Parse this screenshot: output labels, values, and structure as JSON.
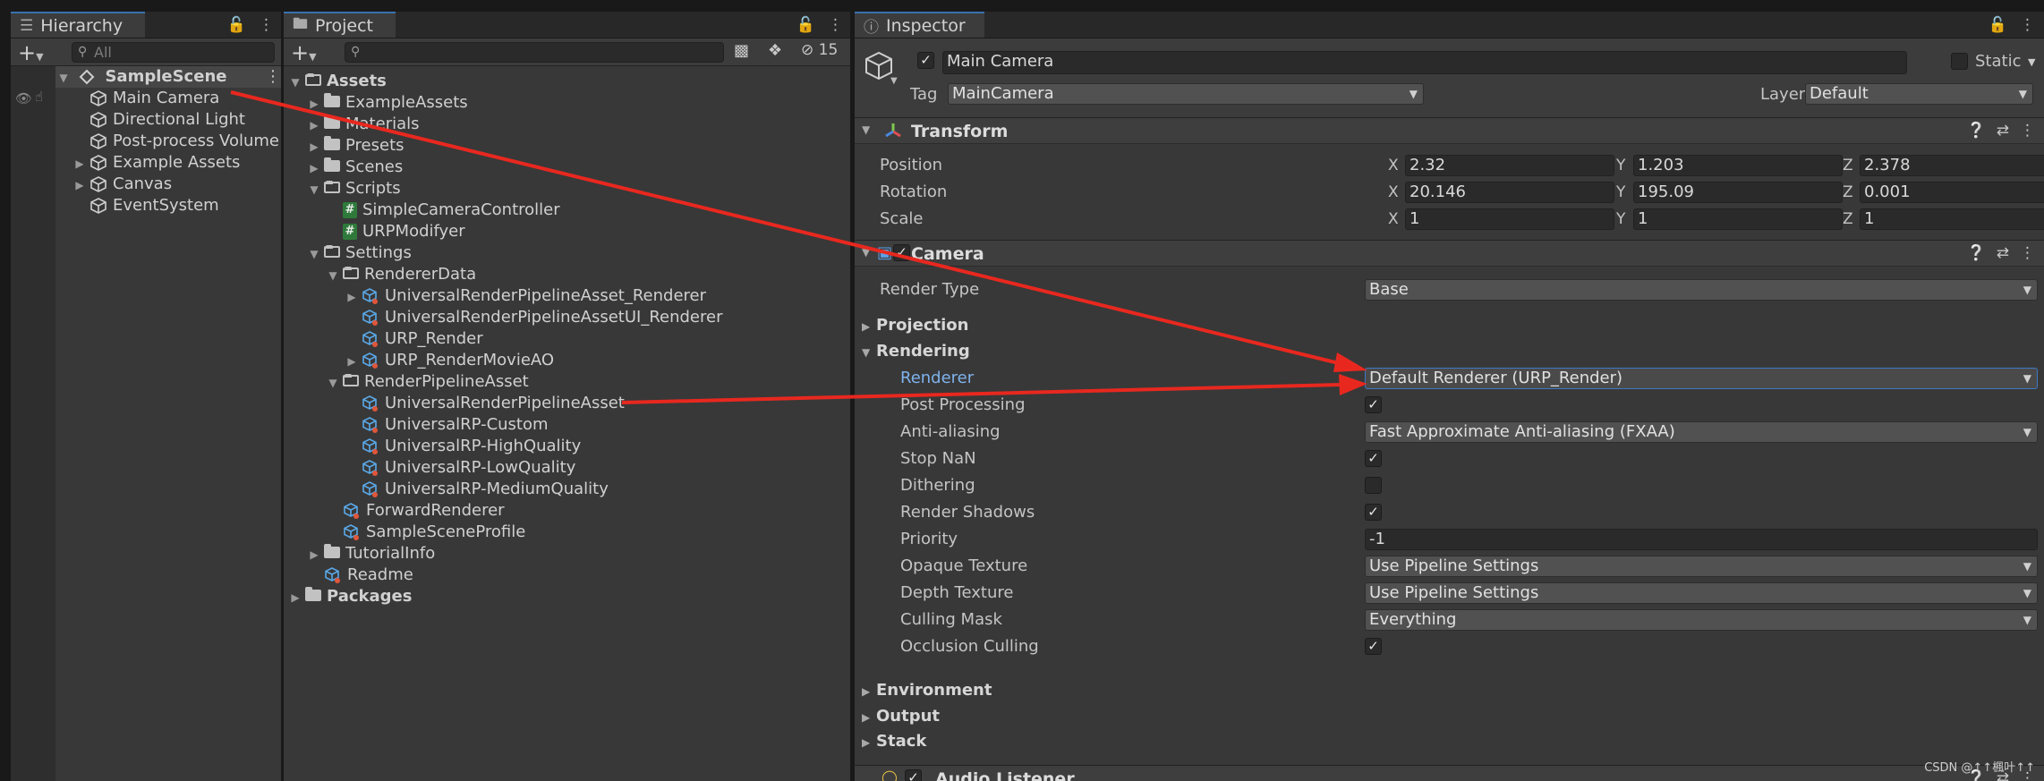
{
  "hierarchy": {
    "tab_label": "Hierarchy",
    "search_placeholder": "All",
    "scene": "SampleScene",
    "items": [
      "Main Camera",
      "Directional Light",
      "Post-process Volume",
      "Example Assets",
      "Canvas",
      "EventSystem"
    ]
  },
  "project": {
    "tab_label": "Project",
    "hidden_count": "15",
    "tree": [
      {
        "label": "Assets",
        "depth": 0,
        "kind": "folder-open",
        "fold": "open",
        "bold": true
      },
      {
        "label": "ExampleAssets",
        "depth": 1,
        "kind": "folder",
        "fold": "closed"
      },
      {
        "label": "Materials",
        "depth": 1,
        "kind": "folder",
        "fold": "closed"
      },
      {
        "label": "Presets",
        "depth": 1,
        "kind": "folder",
        "fold": "closed"
      },
      {
        "label": "Scenes",
        "depth": 1,
        "kind": "folder",
        "fold": "closed"
      },
      {
        "label": "Scripts",
        "depth": 1,
        "kind": "folder-open",
        "fold": "open"
      },
      {
        "label": "SimpleCameraController",
        "depth": 2,
        "kind": "script",
        "fold": "none"
      },
      {
        "label": "URPModifyer",
        "depth": 2,
        "kind": "script",
        "fold": "none"
      },
      {
        "label": "Settings",
        "depth": 1,
        "kind": "folder-open",
        "fold": "open"
      },
      {
        "label": "RendererData",
        "depth": 2,
        "kind": "folder-open",
        "fold": "open"
      },
      {
        "label": "UniversalRenderPipelineAsset_Renderer",
        "depth": 3,
        "kind": "asset",
        "fold": "closed"
      },
      {
        "label": "UniversalRenderPipelineAssetUI_Renderer",
        "depth": 3,
        "kind": "asset",
        "fold": "none"
      },
      {
        "label": "URP_Render",
        "depth": 3,
        "kind": "asset",
        "fold": "none"
      },
      {
        "label": "URP_RenderMovieAO",
        "depth": 3,
        "kind": "asset",
        "fold": "closed"
      },
      {
        "label": "RenderPipelineAsset",
        "depth": 2,
        "kind": "folder-open",
        "fold": "open"
      },
      {
        "label": "UniversalRenderPipelineAsset",
        "depth": 3,
        "kind": "asset",
        "fold": "none"
      },
      {
        "label": "UniversalRP-Custom",
        "depth": 3,
        "kind": "asset",
        "fold": "none"
      },
      {
        "label": "UniversalRP-HighQuality",
        "depth": 3,
        "kind": "asset",
        "fold": "none"
      },
      {
        "label": "UniversalRP-LowQuality",
        "depth": 3,
        "kind": "asset",
        "fold": "none"
      },
      {
        "label": "UniversalRP-MediumQuality",
        "depth": 3,
        "kind": "asset",
        "fold": "none"
      },
      {
        "label": "ForwardRenderer",
        "depth": 2,
        "kind": "asset",
        "fold": "none"
      },
      {
        "label": "SampleSceneProfile",
        "depth": 2,
        "kind": "asset",
        "fold": "none"
      },
      {
        "label": "TutorialInfo",
        "depth": 1,
        "kind": "folder",
        "fold": "closed"
      },
      {
        "label": "Readme",
        "depth": 1,
        "kind": "asset",
        "fold": "none"
      },
      {
        "label": "Packages",
        "depth": 0,
        "kind": "folder",
        "fold": "closed",
        "bold": true
      }
    ]
  },
  "inspector": {
    "tab_label": "Inspector",
    "object_name": "Main Camera",
    "static_label": "Static",
    "tag_label": "Tag",
    "tag_value": "MainCamera",
    "layer_label": "Layer",
    "layer_value": "Default",
    "transform": {
      "title": "Transform",
      "position_label": "Position",
      "rotation_label": "Rotation",
      "scale_label": "Scale",
      "axis_x": "X",
      "axis_y": "Y",
      "axis_z": "Z",
      "position": [
        "2.32",
        "1.203",
        "2.378"
      ],
      "rotation": [
        "20.146",
        "195.09",
        "0.001"
      ],
      "scale": [
        "1",
        "1",
        "1"
      ]
    },
    "camera": {
      "title": "Camera",
      "render_type_label": "Render Type",
      "render_type_value": "Base",
      "projection_label": "Projection",
      "rendering_label": "Rendering",
      "renderer_label": "Renderer",
      "renderer_value": "Default Renderer (URP_Render)",
      "post_processing_label": "Post Processing",
      "antialiasing_label": "Anti-aliasing",
      "antialiasing_value": "Fast Approximate Anti-aliasing (FXAA)",
      "stop_nan_label": "Stop NaN",
      "dithering_label": "Dithering",
      "render_shadows_label": "Render Shadows",
      "priority_label": "Priority",
      "priority_value": "-1",
      "opaque_texture_label": "Opaque Texture",
      "opaque_texture_value": "Use Pipeline Settings",
      "depth_texture_label": "Depth Texture",
      "depth_texture_value": "Use Pipeline Settings",
      "culling_mask_label": "Culling Mask",
      "culling_mask_value": "Everything",
      "occlusion_culling_label": "Occlusion Culling",
      "environment_label": "Environment",
      "output_label": "Output",
      "stack_label": "Stack"
    },
    "audio_listener_title": "Audio Listener"
  },
  "colors": {
    "annotation_arrow": "#e8281f",
    "accent": "#3a72b0"
  },
  "watermark": "CSDN @↑↑楓叶↑↑"
}
